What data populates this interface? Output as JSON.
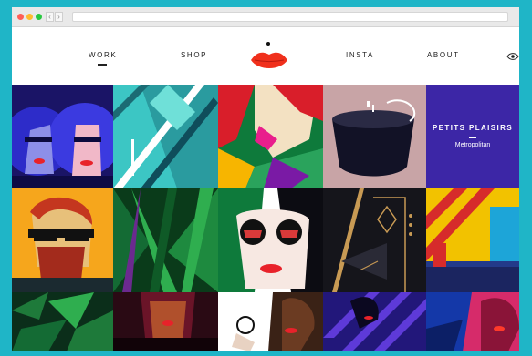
{
  "nav": {
    "items": [
      {
        "label": "WORK",
        "active": true
      },
      {
        "label": "SHOP"
      },
      {
        "label": "INSTA"
      },
      {
        "label": "ABOUT"
      }
    ]
  },
  "featured": {
    "title": "PETITS PLAISIRS",
    "subtitle": "Metropolitan"
  },
  "icons": {
    "logo": "red-lips-logo",
    "toggle": "eye-icon"
  },
  "colors": {
    "frame": "#1fb5c7",
    "featured_bg": "#3c26a6",
    "lips_red": "#f0301c"
  }
}
